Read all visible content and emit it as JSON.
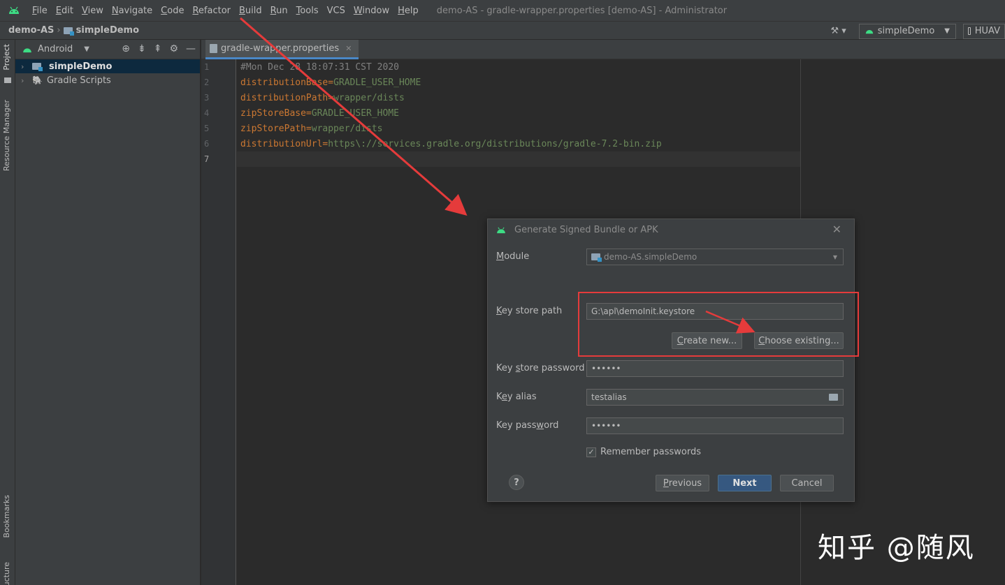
{
  "menubar": {
    "items": [
      {
        "u": "F",
        "rest": "ile"
      },
      {
        "u": "E",
        "rest": "dit"
      },
      {
        "u": "V",
        "rest": "iew"
      },
      {
        "u": "N",
        "rest": "avigate"
      },
      {
        "u": "C",
        "rest": "ode"
      },
      {
        "u": "R",
        "rest": "efactor"
      },
      {
        "u": "B",
        "rest": "uild"
      },
      {
        "u": "R",
        "rest": "un"
      },
      {
        "u": "T",
        "rest": "ools"
      },
      {
        "u": "",
        "rest": "VCS"
      },
      {
        "u": "W",
        "rest": "indow"
      },
      {
        "u": "H",
        "rest": "elp"
      }
    ],
    "window_title": "demo-AS - gradle-wrapper.properties [demo-AS] - Administrator"
  },
  "navbar": {
    "project": "demo-AS",
    "module": "simpleDemo",
    "run_config": "simpleDemo",
    "device": "HUAV"
  },
  "leftstrip": {
    "project_tab": "Project",
    "resource_tab": "Resource Manager",
    "bookmarks_tab": "Bookmarks",
    "structure_tab": "Structure"
  },
  "project_panel": {
    "view": "Android",
    "items": [
      {
        "label": "simpleDemo"
      },
      {
        "label": "Gradle Scripts"
      }
    ]
  },
  "editor": {
    "tab": "gradle-wrapper.properties",
    "line_numbers": [
      "1",
      "2",
      "3",
      "4",
      "5",
      "6",
      "7"
    ],
    "lines": [
      {
        "comment": "#Mon Dec 28 18:07:31 CST 2020"
      },
      {
        "key": "distributionBase",
        "value": "GRADLE_USER_HOME"
      },
      {
        "key": "distributionPath",
        "value": "wrapper/dists"
      },
      {
        "key": "zipStoreBase",
        "value": "GRADLE_USER_HOME"
      },
      {
        "key": "zipStorePath",
        "value": "wrapper/dists"
      },
      {
        "key": "distributionUrl",
        "value": "https\\://services.gradle.org/distributions/gradle-7.2-bin.zip"
      }
    ]
  },
  "dialog": {
    "title": "Generate Signed Bundle or APK",
    "module_label_u": "M",
    "module_label_rest": "odule",
    "module_value": "demo-AS.simpleDemo",
    "keystore_path_label_u": "K",
    "keystore_path_label_rest": "ey store path",
    "keystore_path_value": "G:\\apl\\demoInit.keystore",
    "create_new_u": "C",
    "create_new_rest": "reate new...",
    "choose_existing_u": "C",
    "choose_existing_rest": "hoose existing...",
    "keystore_password_label_a": "Key ",
    "keystore_password_label_u": "s",
    "keystore_password_label_b": "tore password",
    "keystore_password_value": "••••••",
    "key_alias_label_a": "K",
    "key_alias_label_u": "e",
    "key_alias_label_b": "y alias",
    "key_alias_value": "testalias",
    "key_password_label_a": "Key pass",
    "key_password_label_u": "w",
    "key_password_label_b": "ord",
    "key_password_value": "••••••",
    "remember_u": "R",
    "remember_rest": "emember passwords",
    "remember_checked": true,
    "help": "?",
    "previous_u": "P",
    "previous_rest": "revious",
    "next": "Next",
    "cancel": "Cancel"
  },
  "watermark": "知乎 @随风",
  "colors": {
    "annotation_red": "#e53b3b",
    "android_green": "#3ddc84",
    "primary_button": "#365880"
  }
}
